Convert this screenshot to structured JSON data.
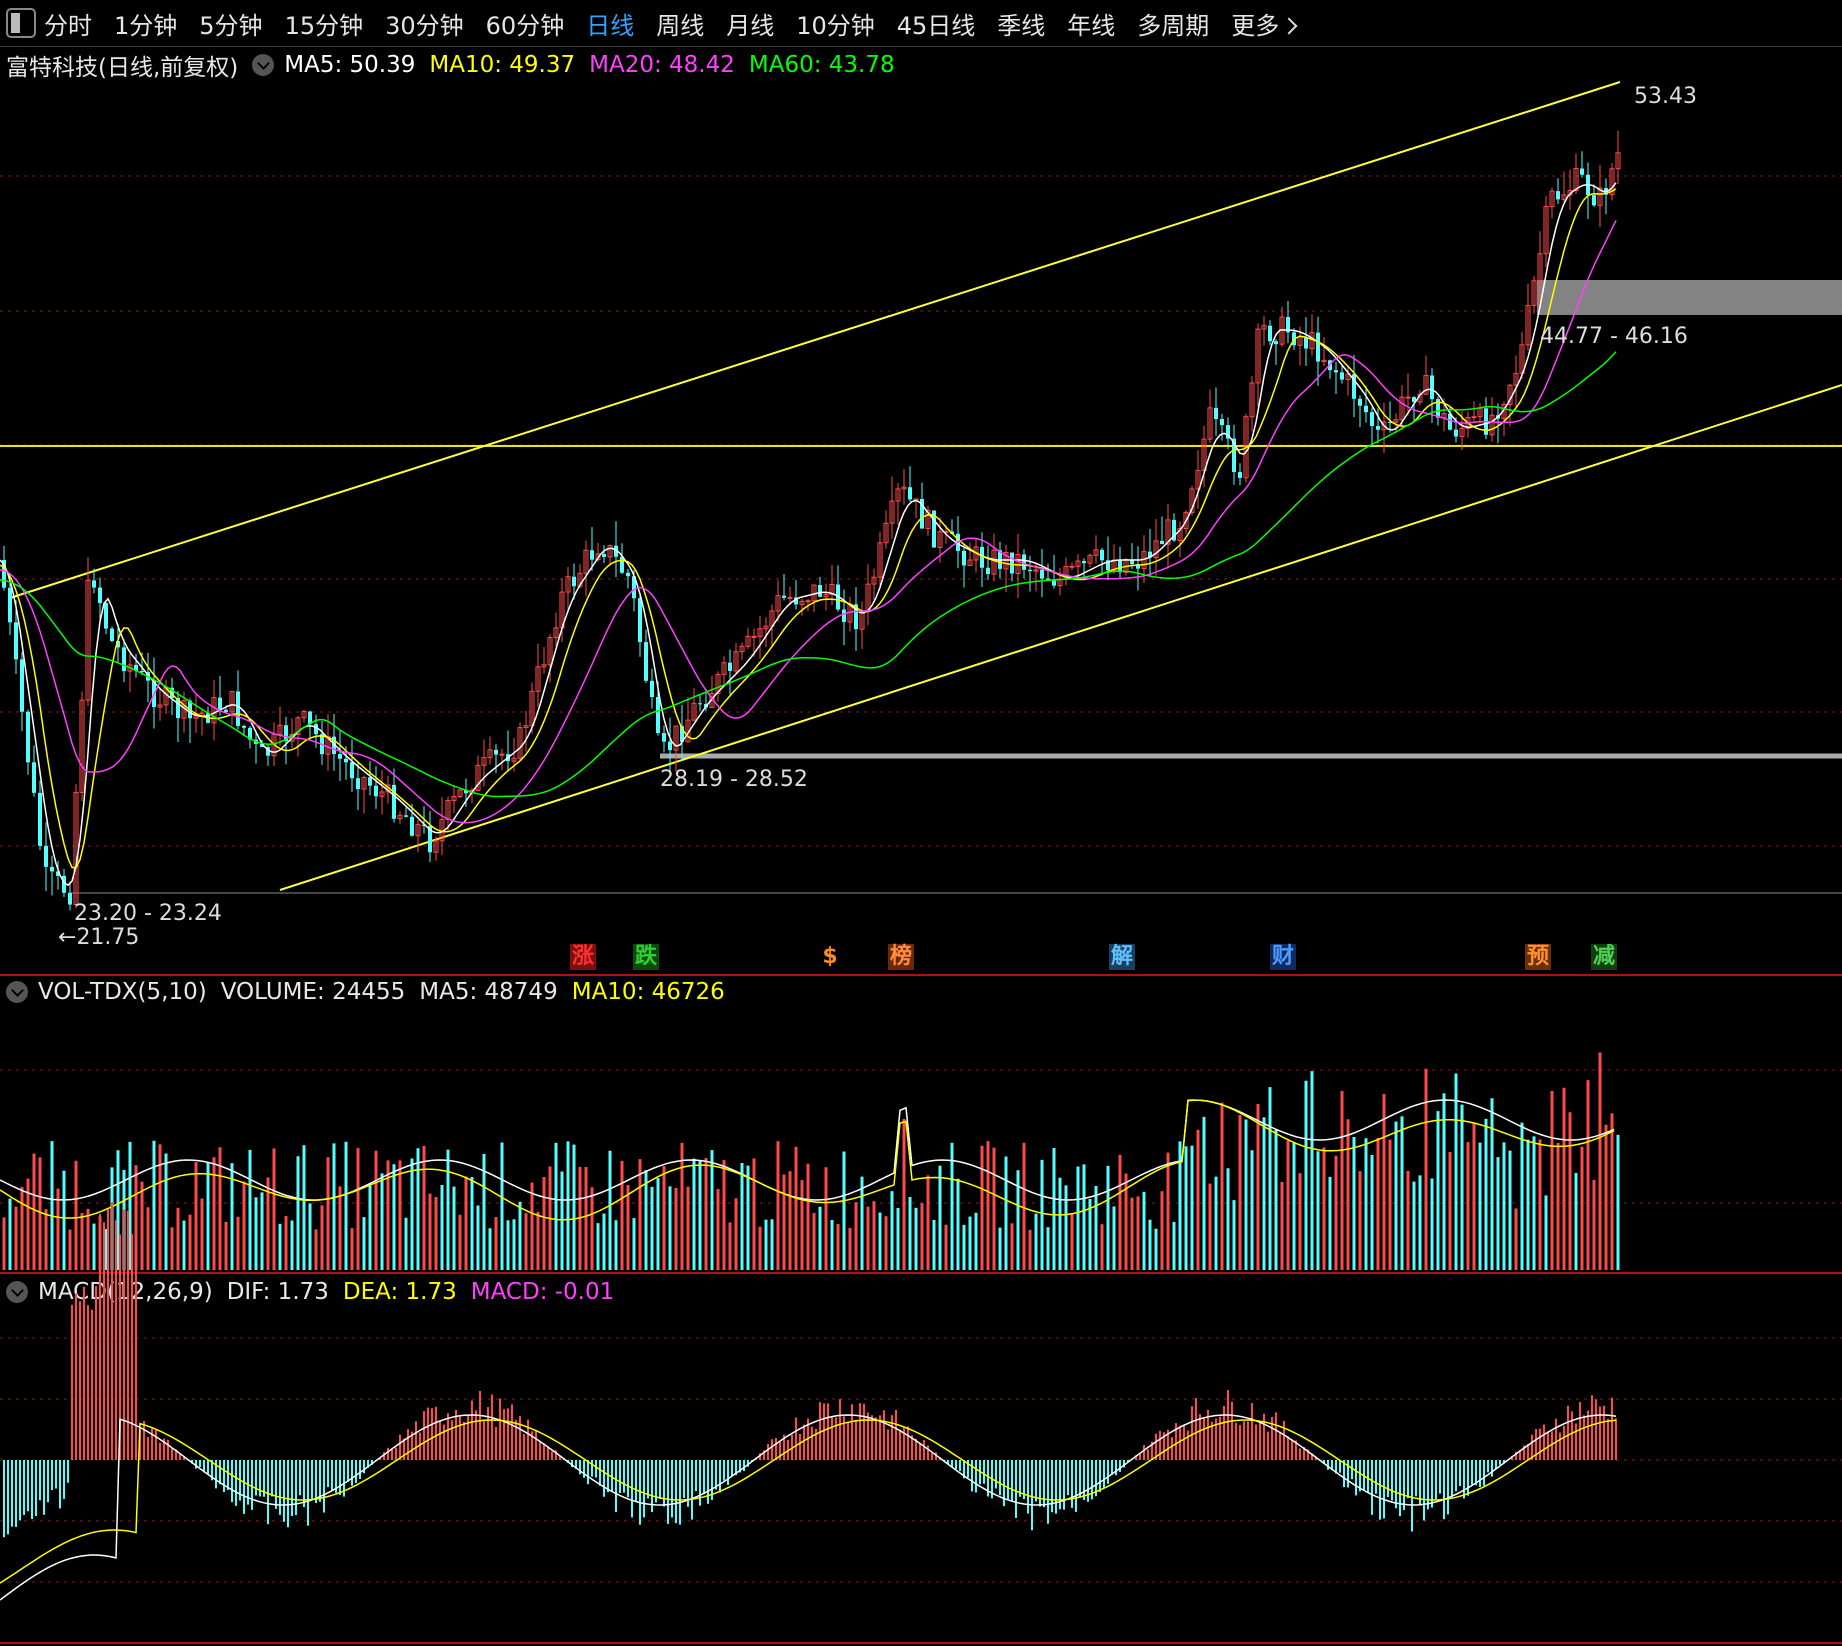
{
  "toolbar": {
    "periods": [
      "分时",
      "1分钟",
      "5分钟",
      "15分钟",
      "30分钟",
      "60分钟",
      "日线",
      "周线",
      "月线",
      "10分钟",
      "45日线",
      "季线",
      "年线",
      "多周期"
    ],
    "more": "更多",
    "active": "日线"
  },
  "main": {
    "title": "富特科技(日线,前复权)",
    "ma5": "MA5: 50.39",
    "ma10": "MA10: 49.37",
    "ma20": "MA20: 48.42",
    "ma60": "MA60: 43.78",
    "annotations": {
      "high": "53.43",
      "zone_high": "44.77 - 46.16",
      "zone_mid": "28.19 - 28.52",
      "zone_low": "23.20 - 23.24",
      "low": "21.75"
    },
    "events": [
      {
        "label": "涨",
        "color": "#ff3030",
        "bg": "#7a1010"
      },
      {
        "label": "跌",
        "color": "#30d030",
        "bg": "#0e4a0e"
      },
      {
        "label": "$",
        "color": "#ff8a20",
        "bg": "#000"
      },
      {
        "label": "榜",
        "color": "#ff8a40",
        "bg": "#6a2a0a"
      },
      {
        "label": "解",
        "color": "#60c0ff",
        "bg": "#1a4060"
      },
      {
        "label": "财",
        "color": "#4a9cff",
        "bg": "#102a60"
      },
      {
        "label": "预",
        "color": "#ff9030",
        "bg": "#6a3008"
      },
      {
        "label": "减",
        "color": "#50d050",
        "bg": "#104010"
      }
    ]
  },
  "volume": {
    "name": "VOL-TDX(5,10)",
    "volume": "VOLUME: 24455",
    "ma5": "MA5: 48749",
    "ma10": "MA10: 46726"
  },
  "macd": {
    "name": "MACD(12,26,9)",
    "dif": "DIF: 1.73",
    "dea": "DEA: 1.73",
    "macd": "MACD: -0.01"
  },
  "colors": {
    "up": "#ff4a4a",
    "down": "#54ffff",
    "ma5": "#ffffff",
    "ma10": "#ffff00",
    "ma20": "#ff40ff",
    "ma60": "#00ff00",
    "grid": "#8a1a1a",
    "border": "#b01010",
    "trendline": "#ffff40",
    "active_tab": "#2fa4ff"
  }
}
